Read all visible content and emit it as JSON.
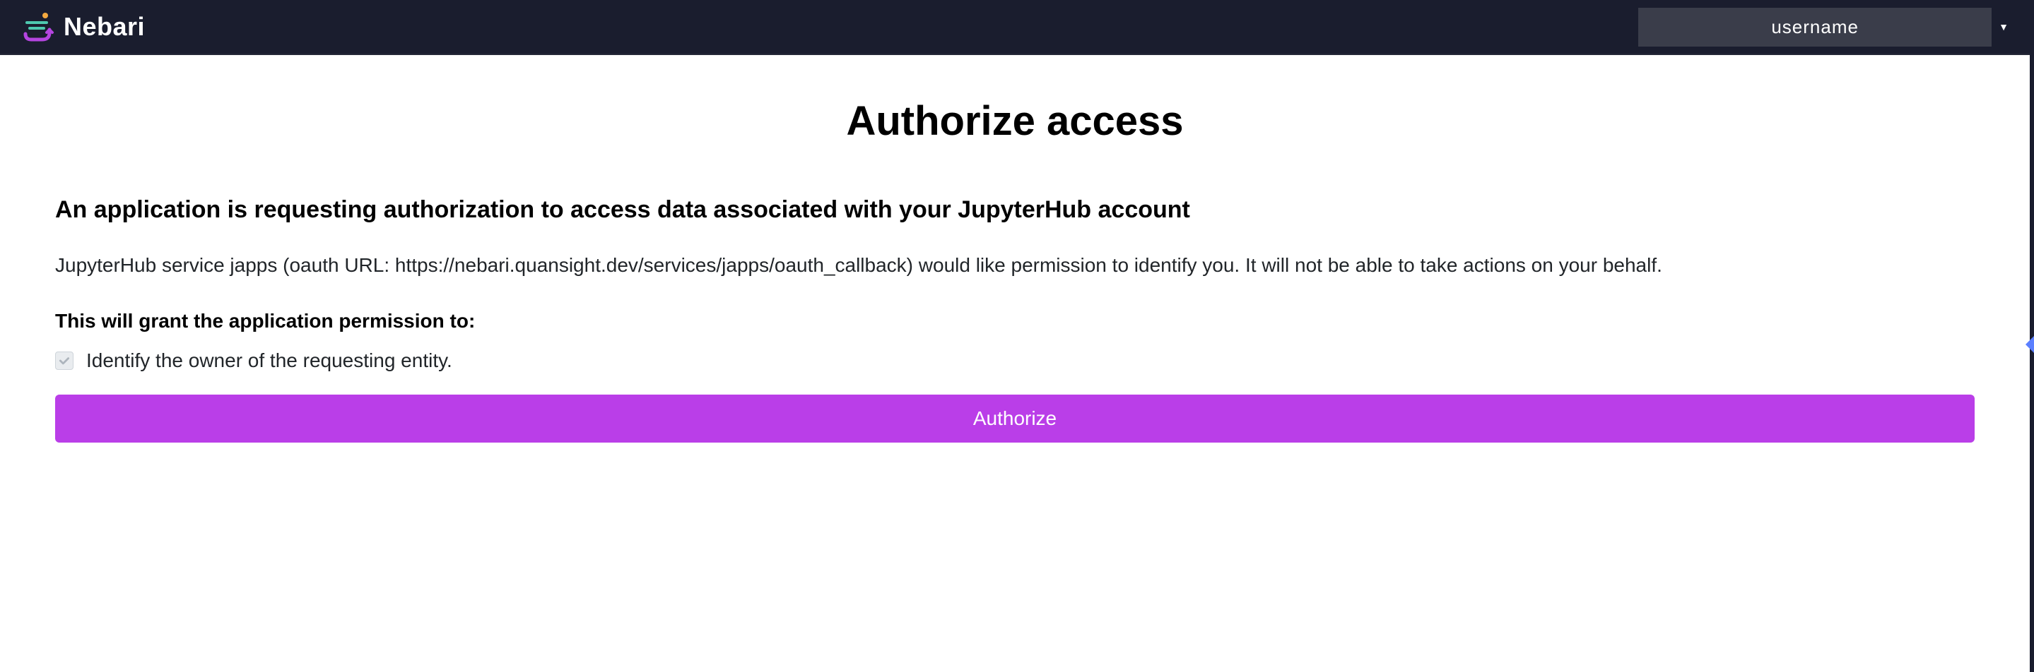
{
  "navbar": {
    "brand_name": "Nebari",
    "username": "username"
  },
  "main": {
    "title": "Authorize access",
    "subtitle": "An application is requesting authorization to access data associated with your JupyterHub account",
    "description": "JupyterHub service japps (oauth URL: https://nebari.quansight.dev/services/japps/oauth_callback) would like permission to identify you. It will not be able to take actions on your behalf.",
    "permissions_heading": "This will grant the application permission to:",
    "permissions": [
      {
        "label": "Identify the owner of the requesting entity.",
        "checked": true,
        "disabled": true
      }
    ],
    "authorize_button_label": "Authorize"
  }
}
